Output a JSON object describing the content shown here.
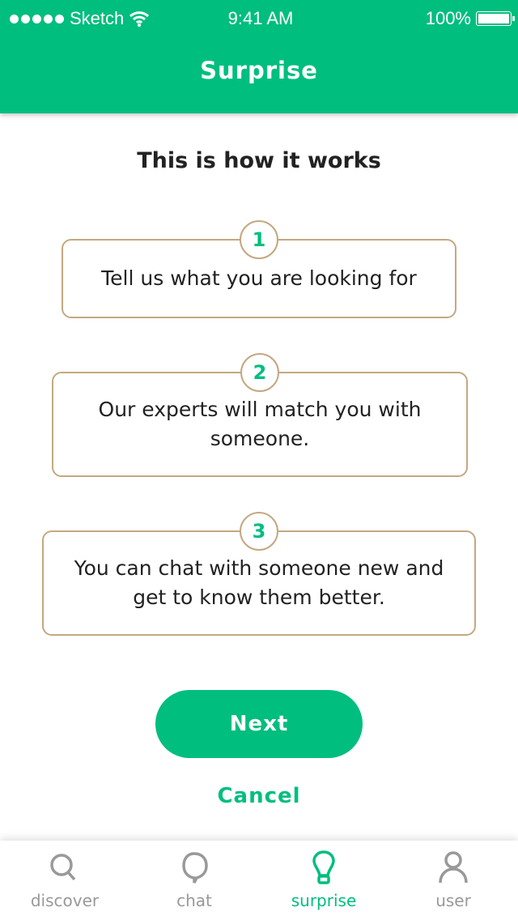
{
  "status_bar": {
    "carrier": "Sketch",
    "time": "9:41 AM",
    "battery": "100%"
  },
  "header": {
    "title": "Surprise"
  },
  "main": {
    "heading": "This is how it works",
    "steps": [
      {
        "number": "1",
        "text": "Tell us what you are looking for"
      },
      {
        "number": "2",
        "text": "Our experts will match you with someone."
      },
      {
        "number": "3",
        "text": "You can chat with someone new and get to know them better."
      }
    ],
    "next_label": "Next",
    "cancel_label": "Cancel"
  },
  "tabbar": {
    "items": [
      {
        "label": "discover",
        "icon": "search-icon"
      },
      {
        "label": "chat",
        "icon": "chat-bubble-icon"
      },
      {
        "label": "surprise",
        "icon": "lightbulb-icon",
        "active": true
      },
      {
        "label": "user",
        "icon": "user-icon"
      }
    ]
  },
  "colors": {
    "accent": "#00BE7E",
    "border": "#C4A882",
    "inactive": "#999999"
  }
}
